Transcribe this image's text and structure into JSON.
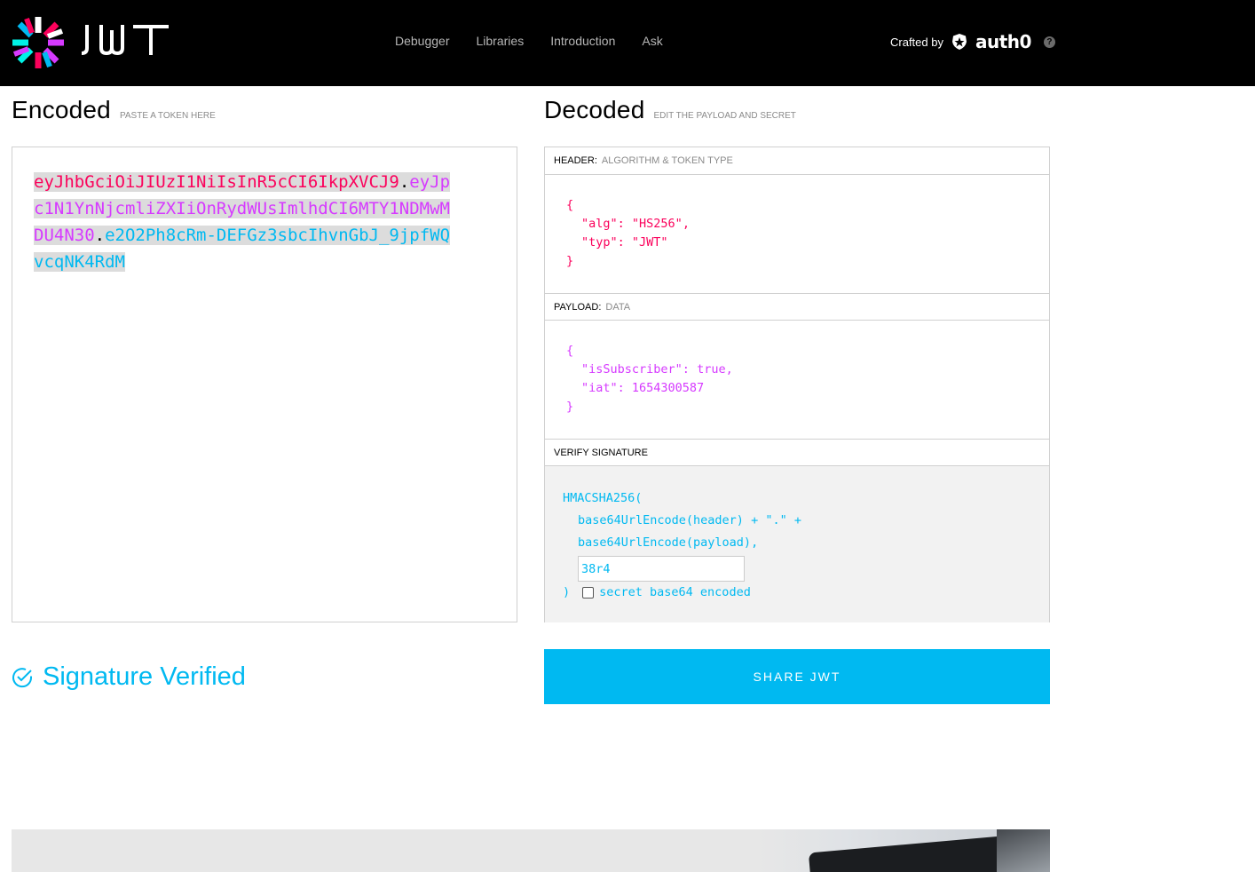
{
  "nav": {
    "items": [
      "Debugger",
      "Libraries",
      "Introduction",
      "Ask"
    ]
  },
  "crafted": {
    "label": "Crafted by",
    "brand": "auth0",
    "help": "?"
  },
  "encoded": {
    "title": "Encoded",
    "subtitle": "PASTE A TOKEN HERE",
    "token_header": "eyJhbGciOiJIUzI1NiIsInR5cCI6IkpXVCJ9",
    "token_payload": "eyJpc1N1YnNjcmliZXIiOnRydWUsImlhdCI6MTY1NDMwMDU4N30",
    "token_signature": "e2O2Ph8cRm-DEFGz3sbcIhvnGbJ_9jpfWQvcqNK4RdM",
    "dot": "."
  },
  "decoded": {
    "title": "Decoded",
    "subtitle": "EDIT THE PAYLOAD AND SECRET",
    "header": {
      "label": "HEADER:",
      "sublabel": "ALGORITHM & TOKEN TYPE",
      "alg_key": "\"alg\"",
      "alg_val": "\"HS256\"",
      "typ_key": "\"typ\"",
      "typ_val": "\"JWT\""
    },
    "payload": {
      "label": "PAYLOAD:",
      "sublabel": "DATA",
      "sub_key": "\"isSubscriber\"",
      "sub_val": "true",
      "iat_key": "\"iat\"",
      "iat_val": "1654300587"
    },
    "verify": {
      "label": "VERIFY SIGNATURE",
      "fn": "HMACSHA256(",
      "line1": "base64UrlEncode(header) + \".\" +",
      "line2": "base64UrlEncode(payload),",
      "secret": "38r4",
      "close": ")",
      "checkbox_label": "secret base64 encoded",
      "checkbox_checked": false
    }
  },
  "status": {
    "verified": "Signature Verified"
  },
  "share": {
    "label": "SHARE JWT"
  },
  "colors": {
    "header": "#fb015b",
    "payload": "#d63aff",
    "signature": "#00b9f1"
  }
}
